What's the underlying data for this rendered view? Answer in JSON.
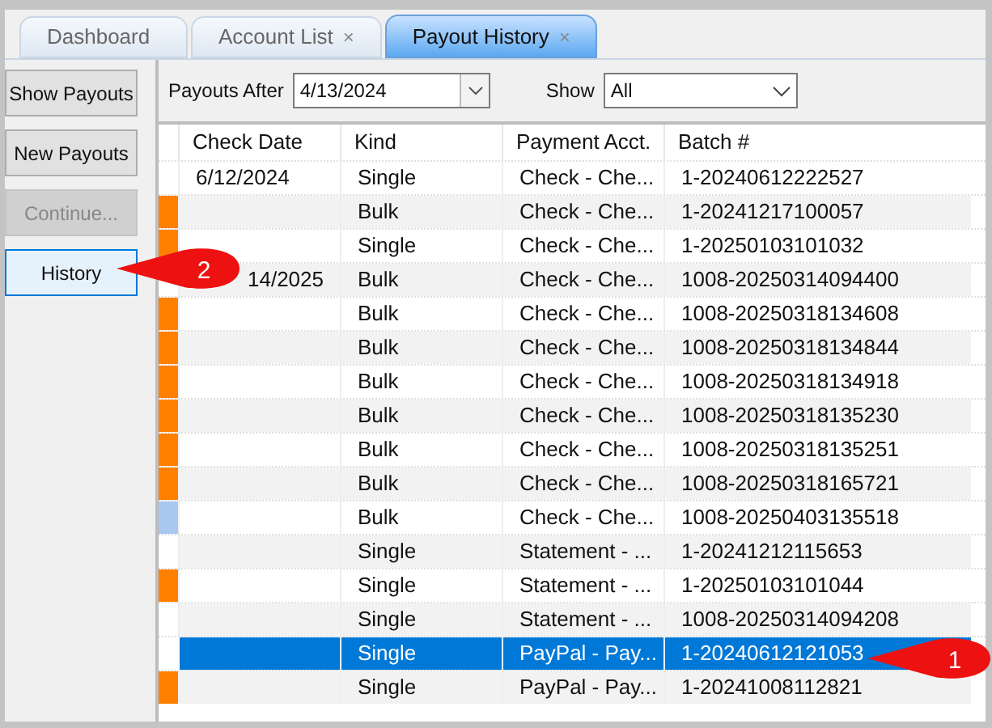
{
  "tabs": [
    {
      "label": "Dashboard",
      "closable": false,
      "selected": false
    },
    {
      "label": "Account List",
      "closable": true,
      "selected": false
    },
    {
      "label": "Payout History",
      "closable": true,
      "selected": true
    }
  ],
  "close_glyph": "×",
  "sidebar": {
    "buttons": [
      {
        "label": "Show Payouts",
        "disabled": false,
        "selected": false
      },
      {
        "label": "New Payouts",
        "disabled": false,
        "selected": false
      },
      {
        "label": "Continue...",
        "disabled": true,
        "selected": false
      },
      {
        "label": "History",
        "disabled": false,
        "selected": true
      }
    ]
  },
  "filters": {
    "payouts_after": {
      "label": "Payouts After",
      "value": "4/13/2024"
    },
    "show": {
      "label": "Show",
      "value": "All"
    }
  },
  "table": {
    "columns": [
      "Check Date",
      "Kind",
      "Payment Acct.",
      "Batch #"
    ],
    "rows": [
      {
        "check_date": "6/12/2024",
        "kind": "Single",
        "payment_acct": "Check - Che...",
        "batch": "1-20240612222527",
        "selected": false
      },
      {
        "color": "#ff8000",
        "kind": "Bulk",
        "payment_acct": "Check - Che...",
        "batch": "1-20241217100057",
        "selected": false
      },
      {
        "color": "#ff8000",
        "kind": "Single",
        "payment_acct": "Check - Che...",
        "batch": "1-20250103101032",
        "selected": false
      },
      {
        "check_date": "14/2025",
        "kind": "Bulk",
        "payment_acct": "Check - Che...",
        "batch": "1008-20250314094400",
        "selected": false
      },
      {
        "color": "#ff8000",
        "kind": "Bulk",
        "payment_acct": "Check - Che...",
        "batch": "1008-20250318134608",
        "selected": false
      },
      {
        "color": "#ff8000",
        "kind": "Bulk",
        "payment_acct": "Check - Che...",
        "batch": "1008-20250318134844",
        "selected": false
      },
      {
        "color": "#ff8000",
        "kind": "Bulk",
        "payment_acct": "Check - Che...",
        "batch": "1008-20250318134918",
        "selected": false
      },
      {
        "color": "#ff8000",
        "kind": "Bulk",
        "payment_acct": "Check - Che...",
        "batch": "1008-20250318135230",
        "selected": false
      },
      {
        "color": "#ff8000",
        "kind": "Bulk",
        "payment_acct": "Check - Che...",
        "batch": "1008-20250318135251",
        "selected": false
      },
      {
        "color": "#ff8000",
        "kind": "Bulk",
        "payment_acct": "Check - Che...",
        "batch": "1008-20250318165721",
        "selected": false
      },
      {
        "color": "#a8c8f0",
        "kind": "Bulk",
        "payment_acct": "Check - Che...",
        "batch": "1008-20250403135518",
        "selected": false
      },
      {
        "kind": "Single",
        "payment_acct": "Statement - ...",
        "batch": "1-20241212115653",
        "selected": false
      },
      {
        "color": "#ff8000",
        "kind": "Single",
        "payment_acct": "Statement - ...",
        "batch": "1-20250103101044",
        "selected": false
      },
      {
        "kind": "Single",
        "payment_acct": "Statement - ...",
        "batch": "1008-20250314094208",
        "selected": false
      },
      {
        "kind": "Single",
        "payment_acct": "PayPal - Pay...",
        "batch": "1-20240612121053",
        "selected": true
      },
      {
        "color": "#ff8000",
        "kind": "Single",
        "payment_acct": "PayPal - Pay...",
        "batch": "1-20241008112821",
        "selected": false
      }
    ]
  },
  "callouts": [
    {
      "label": "1"
    },
    {
      "label": "2"
    }
  ]
}
